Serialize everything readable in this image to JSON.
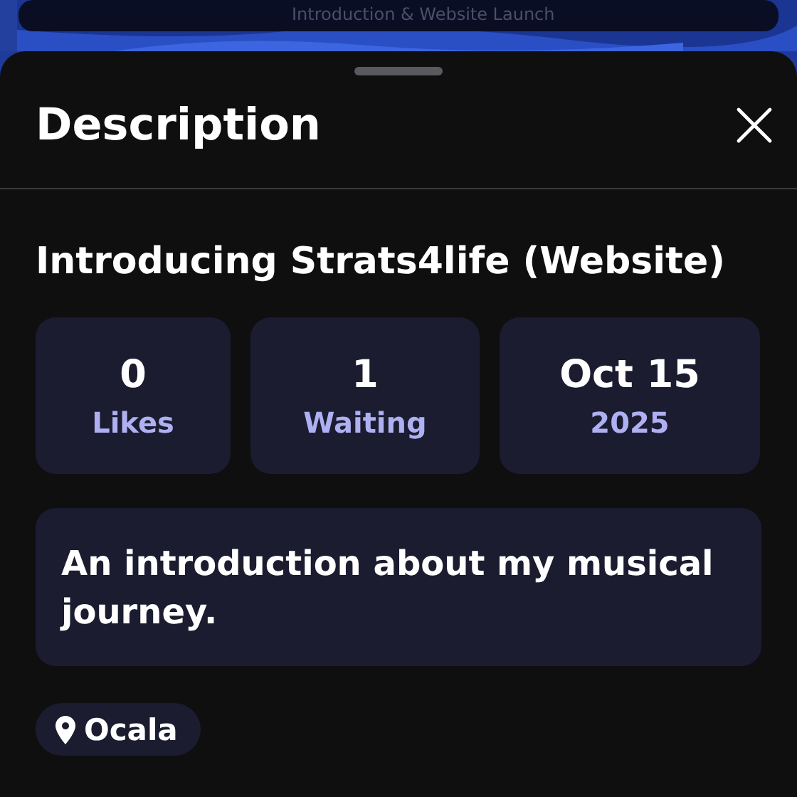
{
  "backdrop": {
    "subtitle": "Introduction & Website Launch"
  },
  "sheet": {
    "title": "Description"
  },
  "event": {
    "title": "Introducing Strats4life (Website)",
    "stats": [
      {
        "value": "0",
        "label": "Likes"
      },
      {
        "value": "1",
        "label": "Waiting"
      },
      {
        "value": "Oct 15",
        "label": "2025"
      }
    ],
    "description": "An introduction about my musical journey.",
    "location": "Ocala"
  }
}
